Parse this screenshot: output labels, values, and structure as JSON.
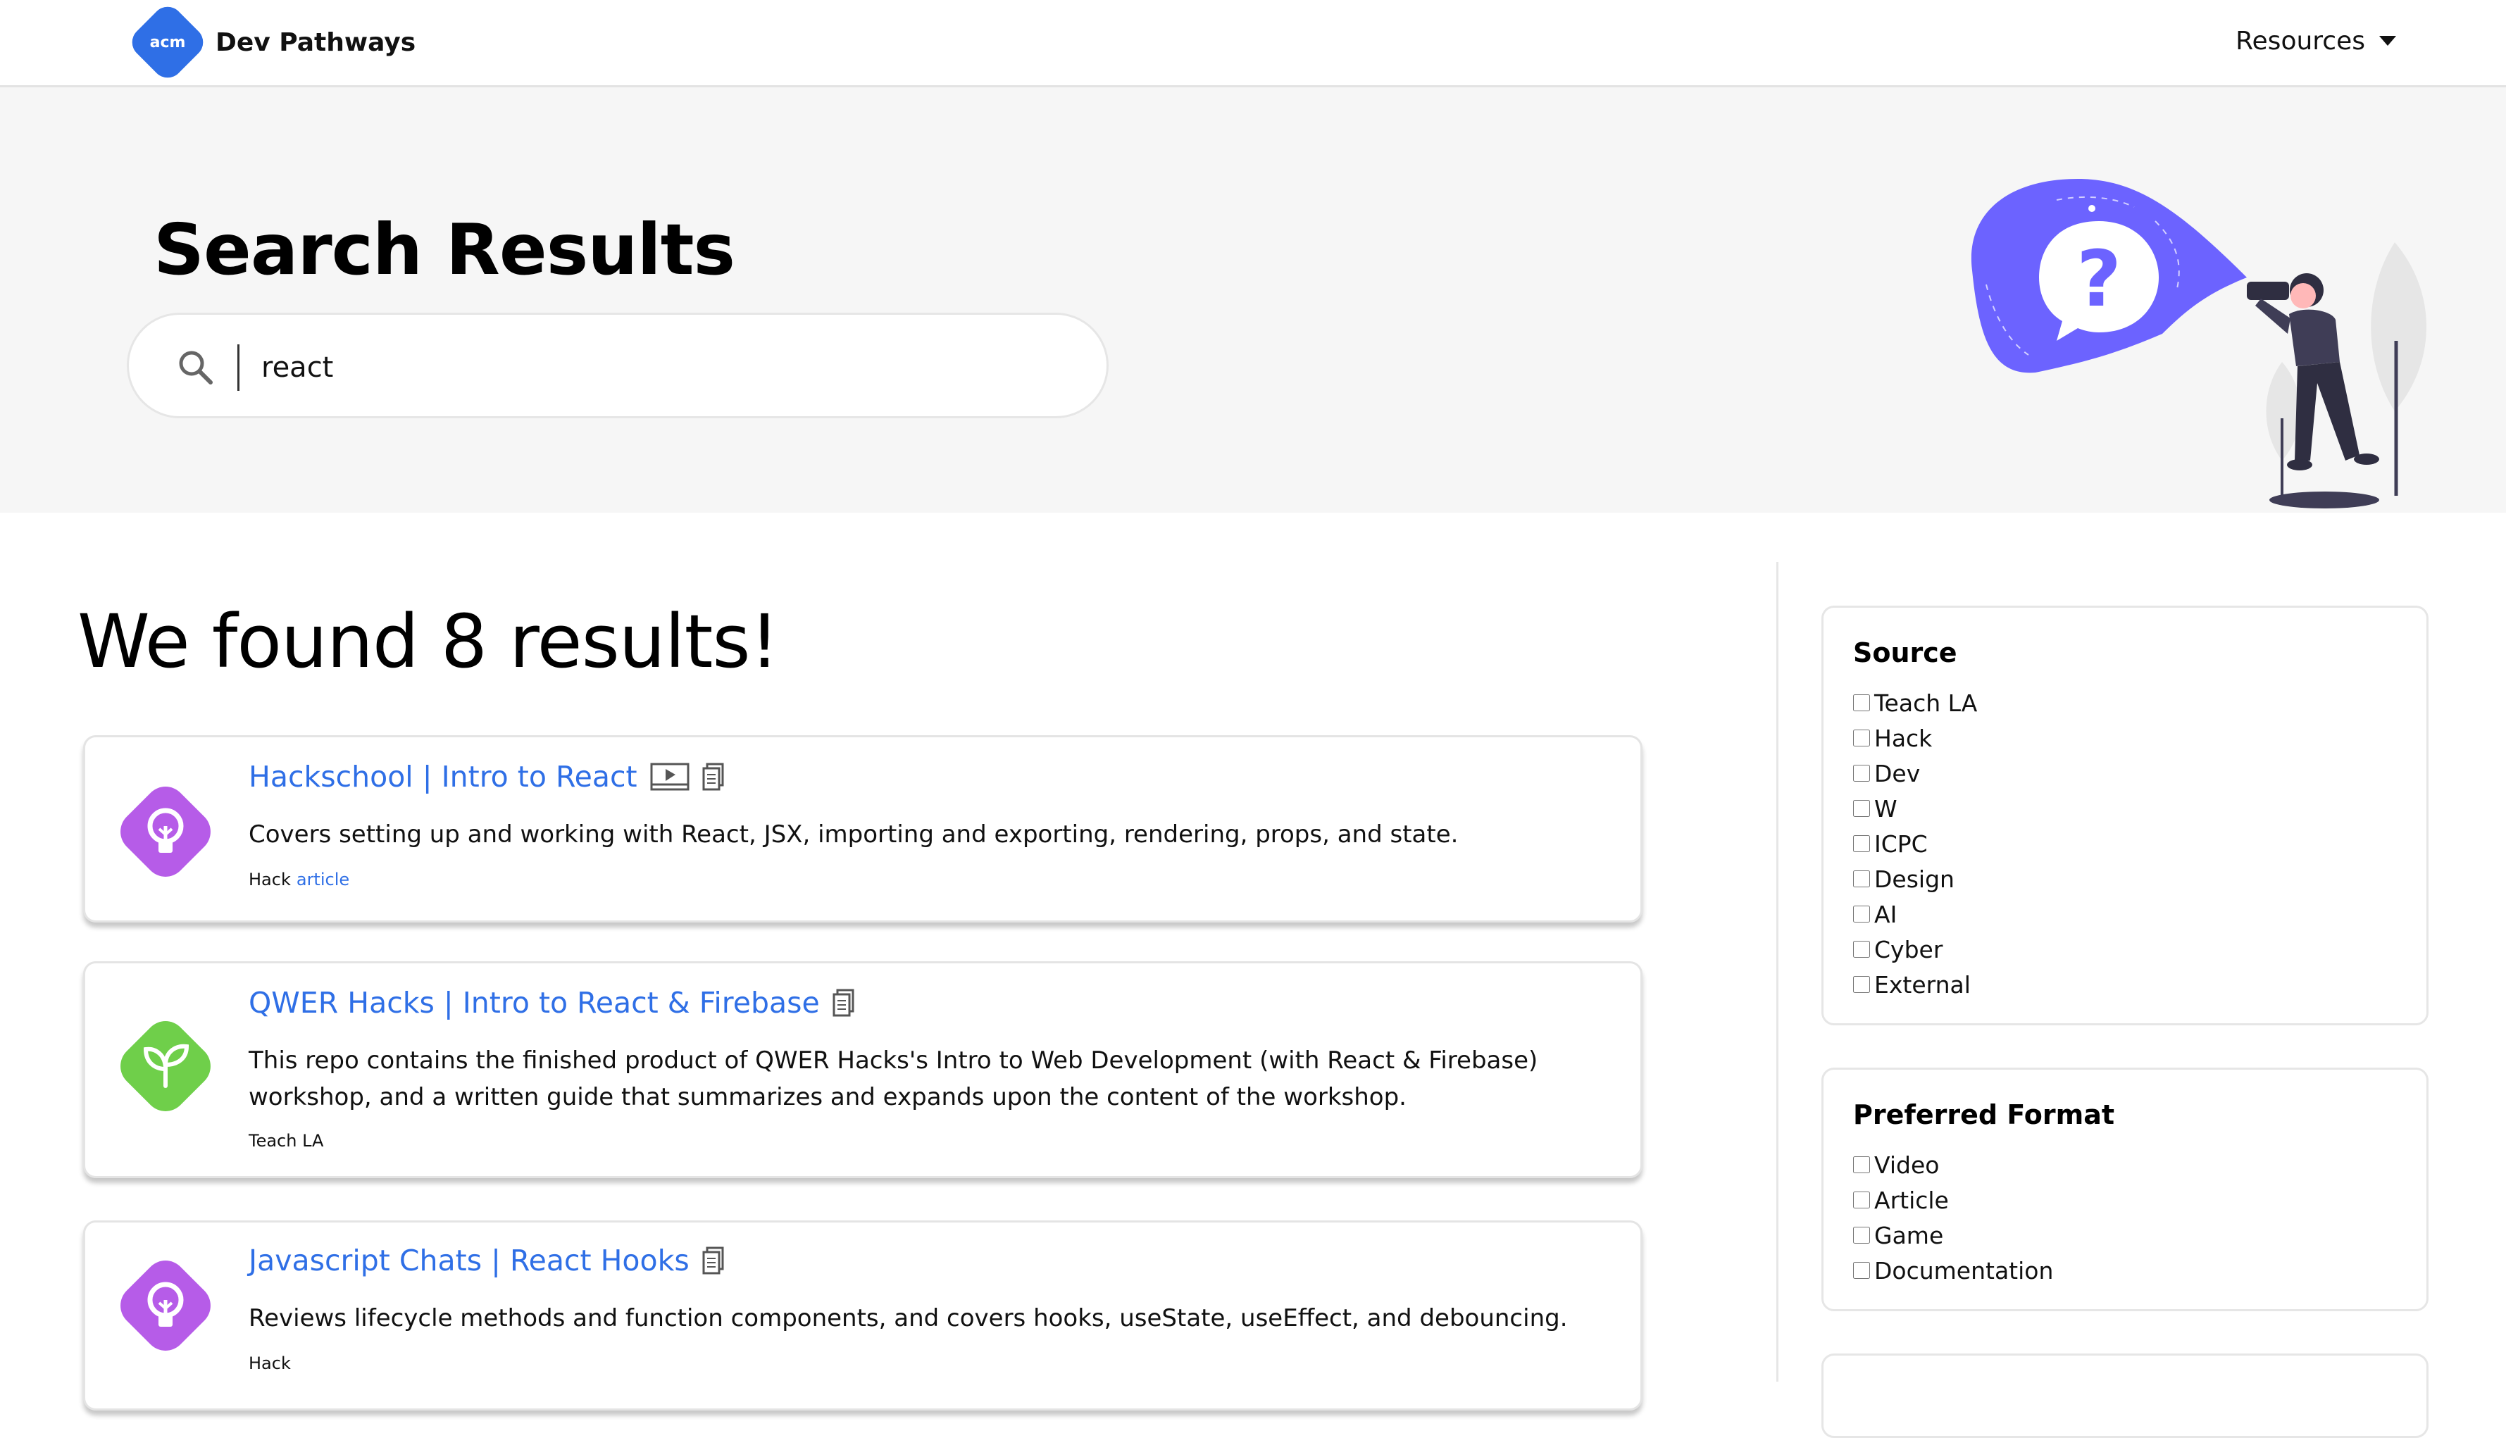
{
  "nav": {
    "logo_text": "acm",
    "brand": "Dev Pathways",
    "resources_label": "Resources"
  },
  "hero": {
    "title": "Search Results",
    "search_value": "react"
  },
  "results": {
    "heading": "We found 8 results!",
    "items": [
      {
        "title": "Hackschool | Intro to React",
        "description": "Covers setting up and working with React, JSX, importing and exporting, rendering, props, and state.",
        "source": "Hack",
        "kind": "article",
        "icon": "lightbulb-icon",
        "icon_color": "#b65ce8",
        "formats": [
          "video-icon",
          "document-icon"
        ]
      },
      {
        "title": "QWER Hacks | Intro to React & Firebase",
        "description": "This repo contains the finished product of QWER Hacks's Intro to Web Development (with React & Firebase) workshop, and a written guide that summarizes and expands upon the content of the workshop.",
        "source": "Teach LA",
        "icon": "sprout-icon",
        "icon_color": "#6fcf4a",
        "formats": [
          "document-icon"
        ]
      },
      {
        "title": "Javascript Chats | React Hooks",
        "description": "Reviews lifecycle methods and function components, and covers hooks, useState, useEffect, and debouncing.",
        "source": "Hack",
        "icon": "lightbulb-icon",
        "icon_color": "#b65ce8",
        "formats": [
          "document-icon"
        ]
      }
    ]
  },
  "filters": {
    "source": {
      "title": "Source",
      "options": [
        "Teach LA",
        "Hack",
        "Dev",
        "W",
        "ICPC",
        "Design",
        "AI",
        "Cyber",
        "External"
      ]
    },
    "format": {
      "title": "Preferred Format",
      "options": [
        "Video",
        "Article",
        "Game",
        "Documentation"
      ]
    }
  },
  "colors": {
    "accent": "#2f6fe6",
    "hack_purple": "#b65ce8",
    "teach_green": "#6fcf4a",
    "illustration_purple": "#6c63ff"
  }
}
